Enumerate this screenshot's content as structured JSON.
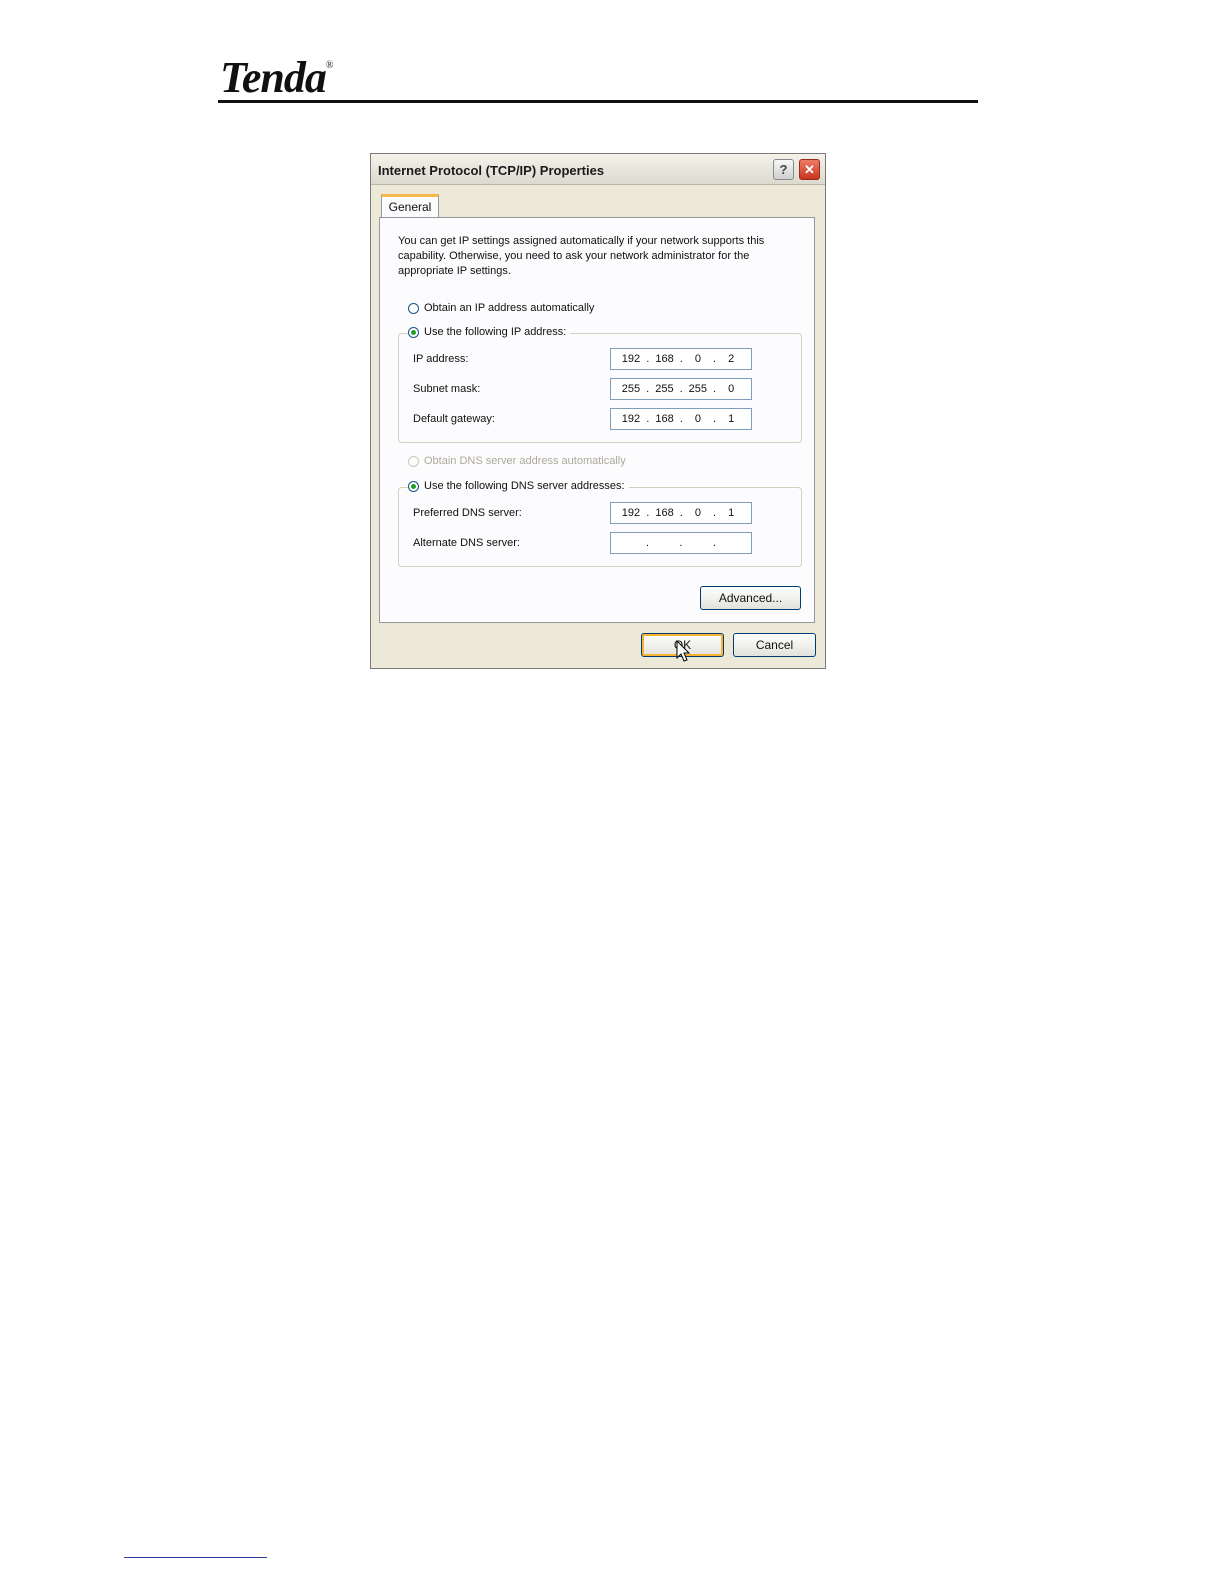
{
  "brand": {
    "logo_text": "Tenda",
    "logo_mark": "®"
  },
  "dialog": {
    "title": "Internet Protocol (TCP/IP) Properties",
    "help_label": "?",
    "close_label": "✕",
    "tab_label": "General",
    "intro_text": "You can get IP settings assigned automatically if your network supports this capability. Otherwise, you need to ask your network administrator for the appropriate IP settings.",
    "ip_mode": {
      "auto_label": "Obtain an IP address automatically",
      "manual_label": "Use the following IP address:",
      "selected": "manual"
    },
    "ip_fields": [
      {
        "label": "IP address:",
        "octets": [
          "192",
          "168",
          "0",
          "2"
        ]
      },
      {
        "label": "Subnet mask:",
        "octets": [
          "255",
          "255",
          "255",
          "0"
        ]
      },
      {
        "label": "Default gateway:",
        "octets": [
          "192",
          "168",
          "0",
          "1"
        ]
      }
    ],
    "dns_mode": {
      "auto_label": "Obtain DNS server address automatically",
      "manual_label": "Use the following DNS server addresses:",
      "selected": "manual",
      "auto_disabled": true
    },
    "dns_fields": [
      {
        "label": "Preferred DNS server:",
        "octets": [
          "192",
          "168",
          "0",
          "1"
        ]
      },
      {
        "label": "Alternate DNS server:",
        "octets": [
          "",
          "",
          "",
          ""
        ]
      }
    ],
    "octet_separator": ".",
    "advanced_label": "Advanced...",
    "ok_label": "OK",
    "cancel_label": "Cancel"
  },
  "colors": {
    "radio_selected": "#21a121",
    "default_button_ring": "#f8b332",
    "close_button": "#c8351d"
  }
}
